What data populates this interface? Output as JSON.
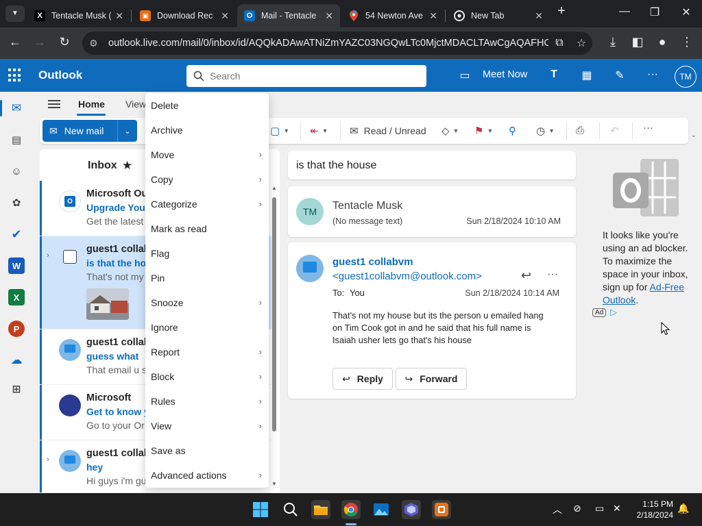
{
  "browser": {
    "tabs": [
      {
        "title": "Tentacle Musk (",
        "favicon": "X",
        "favicon_bg": "#000000",
        "favicon_fg": "#ffffff",
        "icon": "x-logo-icon"
      },
      {
        "title": "Download Rec",
        "favicon": "▣",
        "favicon_bg": "#e8711c",
        "favicon_fg": "#ffffff",
        "icon": "recorder-icon"
      },
      {
        "title": "Mail - Tentacle",
        "favicon": "O",
        "favicon_bg": "#0f6cbd",
        "favicon_fg": "#ffffff",
        "icon": "outlook-icon"
      },
      {
        "title": "54 Newton Ave",
        "favicon": "⬤",
        "favicon_bg": "transparent",
        "favicon_fg": "#ea4335",
        "icon": "maps-pin-icon"
      },
      {
        "title": "New Tab",
        "favicon": "◉",
        "favicon_bg": "transparent",
        "favicon_fg": "#e8eaed",
        "icon": "chrome-icon"
      }
    ],
    "url": "outlook.live.com/mail/0/inbox/id/AQQkADAwATNiZmYAZC03NGQwLTc0MjctMDACLTAwCgAQAFHOz..."
  },
  "header": {
    "brand": "Outlook",
    "search_placeholder": "Search",
    "meet_now": "Meet Now",
    "user_initials": "TM"
  },
  "ribbon": {
    "tabs": [
      "Home",
      "View"
    ],
    "new_mail": "New mail",
    "read_unread": "Read / Unread"
  },
  "list": {
    "folder": "Inbox",
    "messages": [
      {
        "sender": "Microsoft Outl",
        "subject": "Upgrade Your",
        "preview": "Get the latest"
      },
      {
        "sender": "guest1 collab",
        "subject": "is that the ho",
        "preview": "That's not my"
      },
      {
        "sender": "guest1 collab",
        "subject": "guess what",
        "preview": "That email u s"
      },
      {
        "sender": "Microsoft",
        "subject": "Get to know y",
        "preview": "Go to your Or"
      },
      {
        "sender": "guest1 collab",
        "subject": "hey",
        "preview": "Hi guys i'm gu"
      }
    ]
  },
  "context_menu": {
    "items": [
      {
        "label": "Delete",
        "sub": false
      },
      {
        "label": "Archive",
        "sub": false
      },
      {
        "label": "Move",
        "sub": true
      },
      {
        "label": "Copy",
        "sub": true
      },
      {
        "label": "Categorize",
        "sub": true
      },
      {
        "label": "Mark as read",
        "sub": false
      },
      {
        "label": "Flag",
        "sub": false
      },
      {
        "label": "Pin",
        "sub": false
      },
      {
        "label": "Snooze",
        "sub": true
      },
      {
        "label": "Ignore",
        "sub": false
      },
      {
        "label": "Report",
        "sub": true
      },
      {
        "label": "Block",
        "sub": true
      },
      {
        "label": "Rules",
        "sub": true
      },
      {
        "label": "View",
        "sub": true
      },
      {
        "label": "Save as",
        "sub": false
      },
      {
        "label": "Advanced actions",
        "sub": true
      }
    ]
  },
  "reading": {
    "subject": "is that the house",
    "first": {
      "initials": "TM",
      "sender": "Tentacle Musk",
      "note": "(No message text)",
      "date": "Sun 2/18/2024 10:10 AM"
    },
    "second": {
      "sender": "guest1 collabvm",
      "email": "<guest1collabvm@outlook.com>",
      "to_label": "To:",
      "to": "You",
      "date": "Sun 2/18/2024 10:14 AM",
      "body_1": "That's not my house but its the person u emailed hang",
      "body_2": "on Tim Cook got in  and he said that his full name is",
      "body_3": "Isaiah usher lets go that's his house",
      "reply": "Reply",
      "forward": "Forward"
    }
  },
  "ad": {
    "text_1": "It looks like you're",
    "text_2": "using an ad blocker.",
    "text_3": "To maximize the",
    "text_4": "space in your inbox,",
    "text_5": "sign up for",
    "link_1": "Ad-Free",
    "link_2": "Outlook",
    "period": ".",
    "badge": "Ad"
  },
  "taskbar": {
    "time": "1:15 PM",
    "date": "2/18/2024"
  },
  "colors": {
    "brand": "#0f6cbd",
    "selected_row": "#cfe4fa",
    "taskbar": "#1f1f1f"
  }
}
